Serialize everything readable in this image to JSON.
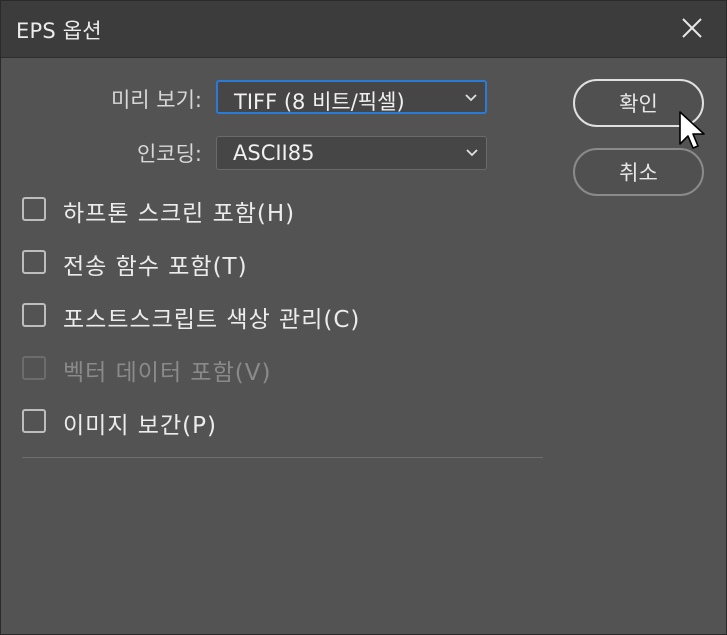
{
  "window": {
    "title": "EPS 옵션"
  },
  "icons": {
    "close": "close-icon",
    "chevron": "chevron-down-icon",
    "cursor": "mouse-pointer-icon"
  },
  "form": {
    "preview": {
      "label": "미리 보기:",
      "value": "TIFF (8 비트/픽셀)"
    },
    "encoding": {
      "label": "인코딩:",
      "value": "ASCII85"
    }
  },
  "buttons": {
    "ok": "확인",
    "cancel": "취소"
  },
  "options": [
    {
      "label": "하프톤 스크린 포함(H)",
      "checked": false,
      "enabled": true
    },
    {
      "label": "전송 함수 포함(T)",
      "checked": false,
      "enabled": true
    },
    {
      "label": "포스트스크립트 색상 관리(C)",
      "checked": false,
      "enabled": true
    },
    {
      "label": "벡터 데이터 포함(V)",
      "checked": false,
      "enabled": false
    },
    {
      "label": "이미지 보간(P)",
      "checked": false,
      "enabled": true
    }
  ],
  "colors": {
    "accent": "#2a7bd8",
    "background": "#535353",
    "titlebar": "#3c3c3c"
  }
}
